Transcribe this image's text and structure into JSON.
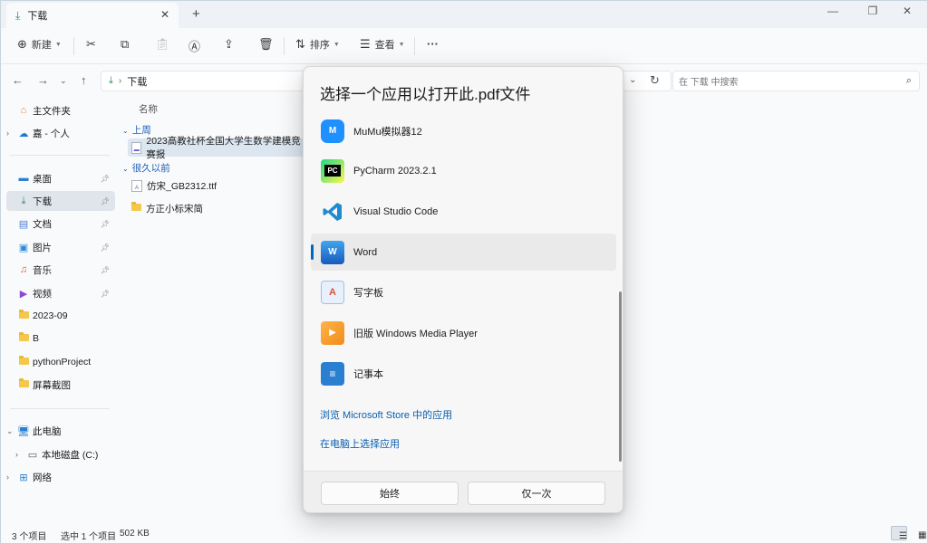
{
  "tab": {
    "title": "下载"
  },
  "toolbar": {
    "new_label": "新建",
    "sort_label": "排序",
    "view_label": "查看",
    "more_label": "···"
  },
  "address": {
    "current": "下载",
    "search_placeholder": "在 下载 中搜索"
  },
  "sidebar": {
    "home": "主文件夹",
    "cloud": "嘉 - 个人",
    "desktop": "桌面",
    "downloads": "下载",
    "documents": "文档",
    "pictures": "图片",
    "music": "音乐",
    "videos": "视频",
    "folder1": "2023-09",
    "folder2": "B",
    "folder3": "pythonProject",
    "folder4": "屏幕截图",
    "this_pc": "此电脑",
    "local_disk": "本地磁盘 (C:)",
    "network": "网络"
  },
  "content": {
    "column_name": "名称",
    "group_last_week": "上周",
    "group_long_ago": "很久以前",
    "files": [
      {
        "name": "2023高教社杯全国大学生数学建模竞赛报",
        "icon": "pdf-file-icon"
      },
      {
        "name": "仿宋_GB2312.ttf",
        "icon": "font-file-icon"
      },
      {
        "name": "方正小标宋简",
        "icon": "folder-icon"
      }
    ]
  },
  "status": {
    "count": "3 个项目",
    "selected": "选中 1 个项目",
    "size": "502 KB"
  },
  "dialog": {
    "title": "选择一个应用以打开此.pdf文件",
    "apps": [
      {
        "name": "MuMu模拟器12",
        "icon": "mumu-icon",
        "color": "#1e90ff"
      },
      {
        "name": "PyCharm 2023.2.1",
        "icon": "pycharm-icon",
        "color": "#1d1d1d"
      },
      {
        "name": "Visual Studio Code",
        "icon": "vscode-icon",
        "color": "#1f8ad2"
      },
      {
        "name": "Word",
        "icon": "word-icon",
        "color": "#185abd"
      },
      {
        "name": "写字板",
        "icon": "wordpad-icon",
        "color": "#4a90d9"
      },
      {
        "name": "旧版 Windows Media Player",
        "icon": "media-player-icon",
        "color": "#f08c1c"
      },
      {
        "name": "记事本",
        "icon": "notepad-icon",
        "color": "#2a7fd0"
      }
    ],
    "selected_app": "Word",
    "link_store": "浏览 Microsoft Store 中的应用",
    "link_local": "在电脑上选择应用",
    "btn_always": "始终",
    "btn_once": "仅一次"
  }
}
